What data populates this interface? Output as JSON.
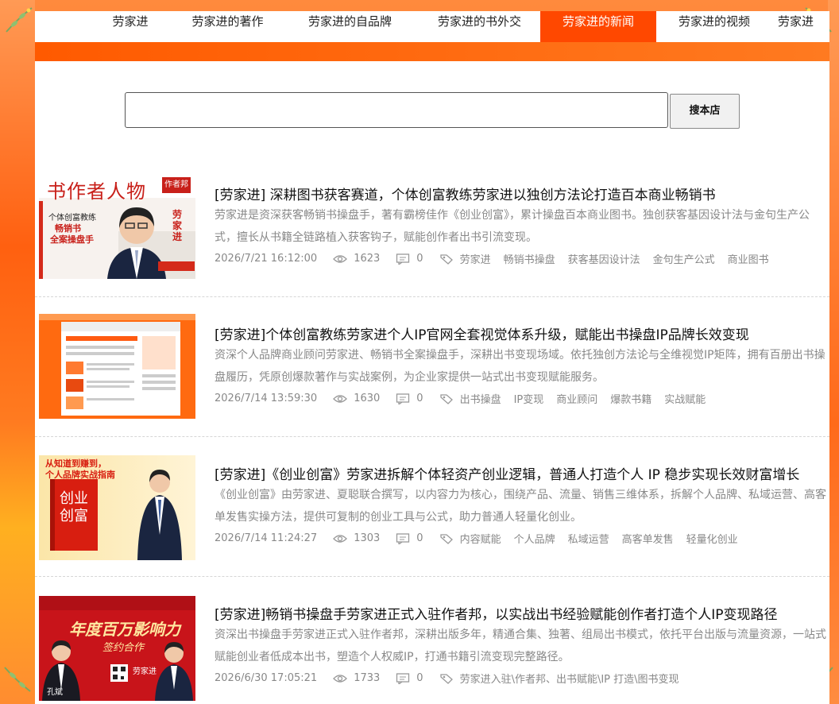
{
  "nav": {
    "items": [
      {
        "label": "劳家进",
        "active": false
      },
      {
        "label": "劳家进的著作",
        "active": false
      },
      {
        "label": "劳家进的自品牌",
        "active": false
      },
      {
        "label": "劳家进的书外交",
        "active": false
      },
      {
        "label": "劳家进的新闻",
        "active": true
      },
      {
        "label": "劳家进的视频",
        "active": false
      },
      {
        "label": "劳家进",
        "active": false
      }
    ]
  },
  "search": {
    "value": "",
    "placeholder": "",
    "button_label": "搜本店"
  },
  "articles": [
    {
      "title": "[劳家进] 深耕图书获客赛道，个体创富教练劳家进以独创方法论打造百本商业畅销书",
      "summary": "劳家进是资深获客畅销书操盘手，著有霸榜佳作《创业创富》，累计操盘百本商业图书。独创获客基因设计法与金句生产公式，擅长从书籍全链路植入获客钩子，赋能创作者出书引流变现。",
      "date": "2026/7/21 16:12:00",
      "views": "1623",
      "comments": "0",
      "tags": [
        "劳家进",
        "畅销书操盘",
        "获客基因设计法",
        "金句生产公式",
        "商业图书"
      ],
      "thumb": {
        "heading": "书作者人物",
        "badge": "作者邦",
        "line1": "个体创富教练",
        "line2": "畅销书",
        "line3": "全案操盘手",
        "name": "劳家进"
      }
    },
    {
      "title": "[劳家进]个体创富教练劳家进个人IP官网全套视觉体系升级，赋能出书操盘IP品牌长效变现",
      "summary": "资深个人品牌商业顾问劳家进、畅销书全案操盘手，深耕出书变现场域。依托独创方法论与全维视觉IP矩阵，拥有百册出书操盘履历，凭原创爆款著作与实战案例，为企业家提供一站式出书变现赋能服务。",
      "date": "2026/7/14 13:59:30",
      "views": "1630",
      "comments": "0",
      "tags": [
        "出书操盘",
        "IP变现",
        "商业顾问",
        "爆款书籍",
        "实战赋能"
      ]
    },
    {
      "title": "[劳家进]《创业创富》劳家进拆解个体轻资产创业逻辑，普通人打造个人 IP 稳步实现长效财富增长",
      "summary": "《创业创富》由劳家进、夏聪联合撰写，以内容力为核心，围绕产品、流量、销售三维体系，拆解个人品牌、私域运营、高客单发售实操方法，提供可复制的创业工具与公式，助力普通人轻量化创业。",
      "date": "2026/7/14 11:24:27",
      "views": "1303",
      "comments": "0",
      "tags": [
        "内容赋能",
        "个人品牌",
        "私域运营",
        "高客单发售",
        "轻量化创业"
      ],
      "thumb": {
        "line1": "从知道到赚到，",
        "line2": "个人品牌实战指南",
        "book1": "创业",
        "book2": "创富"
      }
    },
    {
      "title": "[劳家进]畅销书操盘手劳家进正式入驻作者邦，以实战出书经验赋能创作者打造个人IP变现路径",
      "summary": "资深出书操盘手劳家进正式入驻作者邦，深耕出版多年，精通合集、独著、组局出书模式，依托平台出版与流量资源，一站式赋能创业者低成本出书，塑造个人权威IP，打通书籍引流变现完整路径。",
      "date": "2026/6/30 17:05:21",
      "views": "1733",
      "comments": "0",
      "tags": [
        "劳家进入驻\\作者邦、出书赋能\\IP 打造\\图书变现"
      ],
      "thumb": {
        "banner": "年度百万影响力",
        "sub": "签约合作",
        "left_name": "孔斌",
        "right_name": "劳家进"
      }
    }
  ],
  "colors": {
    "accent": "#ff4800",
    "frame": "#ff6a1a",
    "meta": "#888888"
  }
}
